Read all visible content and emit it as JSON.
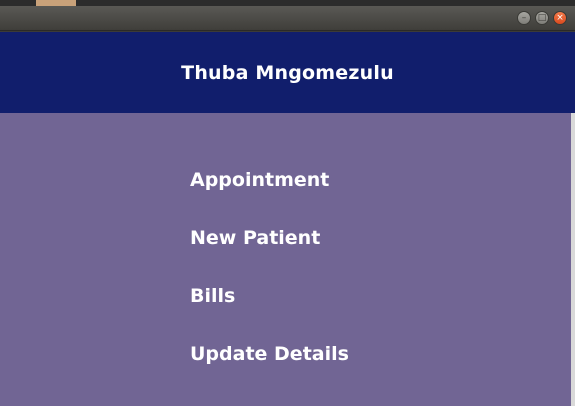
{
  "window": {
    "controls": {
      "minimize_icon": "minimize-icon",
      "maximize_icon": "maximize-icon",
      "close_icon": "close-icon"
    }
  },
  "header": {
    "title": "Thuba Mngomezulu"
  },
  "menu": {
    "items": [
      {
        "label": "Appointment"
      },
      {
        "label": "New Patient"
      },
      {
        "label": "Bills"
      },
      {
        "label": "Update Details"
      }
    ]
  },
  "colors": {
    "header_bg": "#111e6c",
    "menu_bg": "#716594",
    "text": "#ffffff",
    "close_button": "#e9582a"
  }
}
